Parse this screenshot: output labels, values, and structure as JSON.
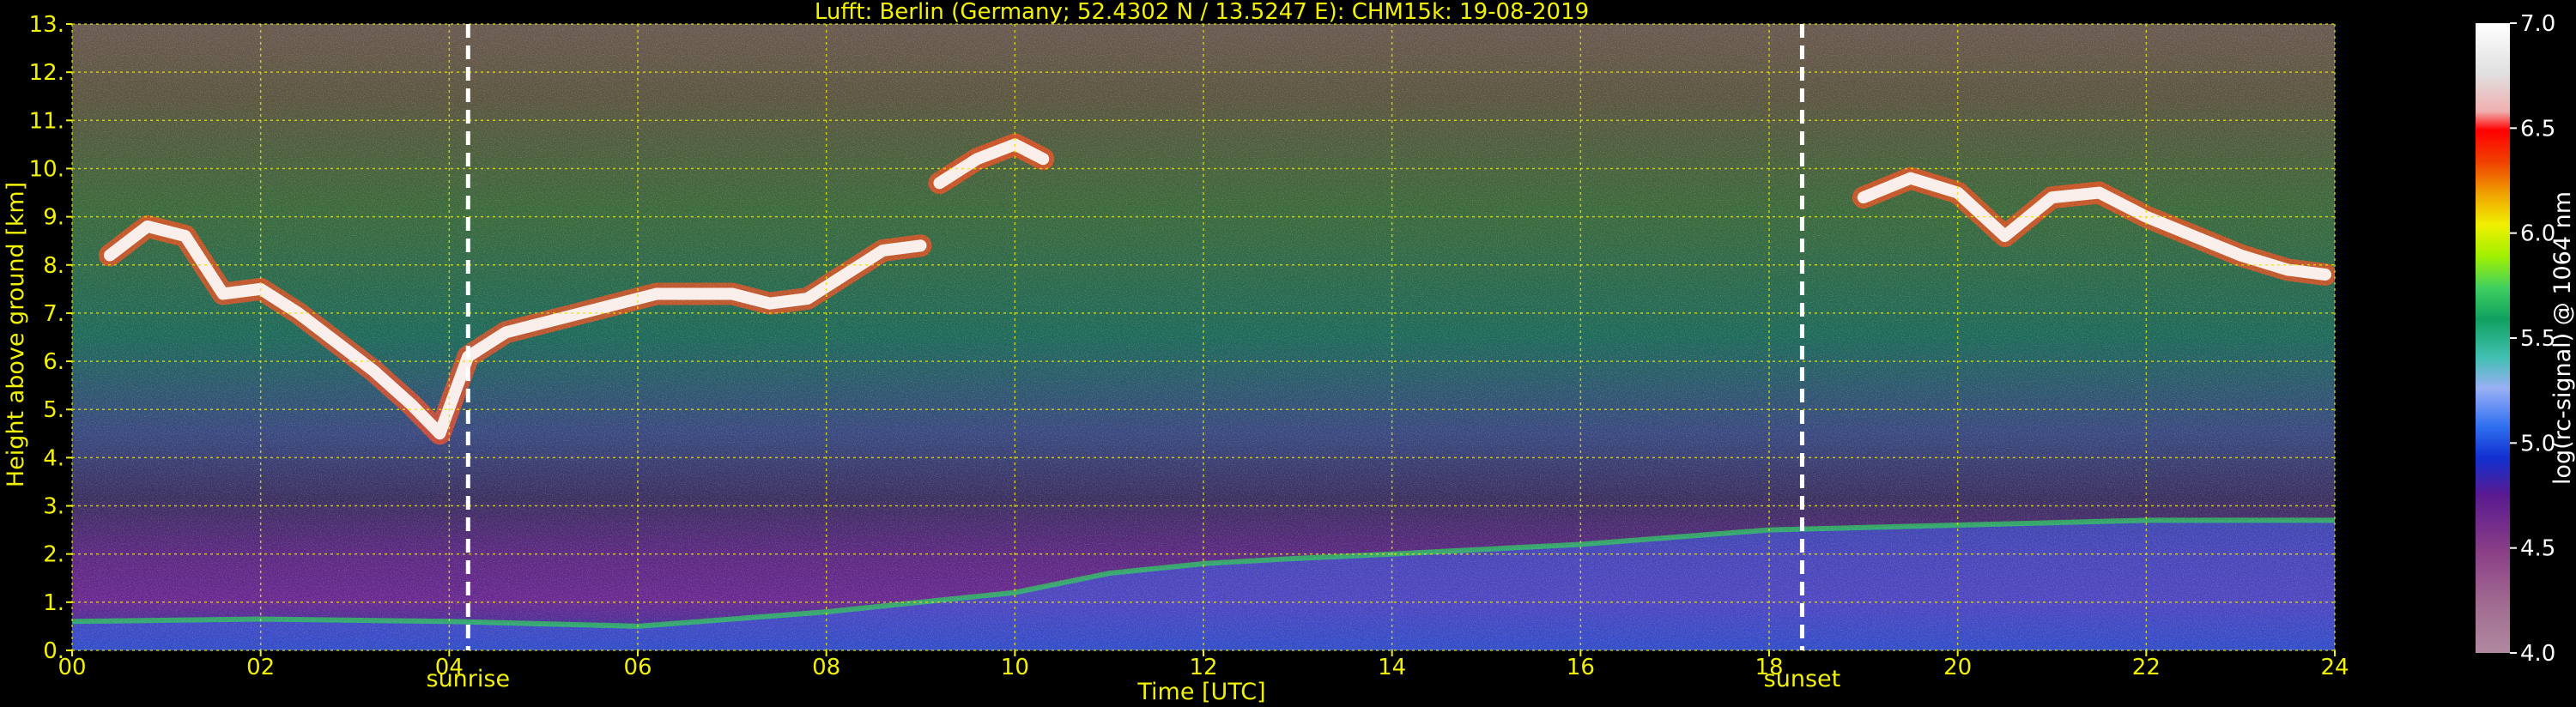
{
  "chart_data": {
    "type": "heatmap",
    "title": "Lufft: Berlin (Germany; 52.4302 N / 13.5247 E):    CHM15k: 19-08-2019",
    "xlabel": "Time [UTC]",
    "ylabel": "Height above ground [km]",
    "xlim": [
      0,
      24
    ],
    "ylim": [
      0,
      13
    ],
    "x_ticks": [
      0,
      2,
      4,
      6,
      8,
      10,
      12,
      14,
      16,
      18,
      20,
      22,
      24
    ],
    "x_tick_labels": [
      "00",
      "02",
      "04",
      "06",
      "08",
      "10",
      "12",
      "14",
      "16",
      "18",
      "20",
      "22",
      "24"
    ],
    "y_ticks": [
      0,
      1,
      2,
      3,
      4,
      5,
      6,
      7,
      8,
      9,
      10,
      11,
      12,
      13
    ],
    "y_tick_labels": [
      "0.",
      "1.",
      "2.",
      "3.",
      "4.",
      "5.",
      "6.",
      "7.",
      "8.",
      "9.",
      "10.",
      "11.",
      "12.",
      "13."
    ],
    "grid": true,
    "markers": [
      {
        "label": "sunrise",
        "x": 4.2
      },
      {
        "label": "sunset",
        "x": 18.35
      }
    ],
    "colorbar": {
      "label": "log(rc-signal) @ 1064 nm",
      "range": [
        4.0,
        7.0
      ],
      "ticks": [
        4.0,
        4.5,
        5.0,
        5.5,
        6.0,
        6.5,
        7.0
      ],
      "tick_labels": [
        "4.0",
        "4.5",
        "5.0",
        "5.5",
        "6.0",
        "6.5",
        "7.0"
      ],
      "colors": [
        "#b08aa0",
        "#a06a90",
        "#8a3f86",
        "#6a1f88",
        "#3a1aa0",
        "#1030d0",
        "#2060f0",
        "#6090f0",
        "#9ab0f5",
        "#a0d4f0",
        "#40c0b0",
        "#10a060",
        "#20b040",
        "#40d060",
        "#60e070",
        "#a0f000",
        "#f0f000",
        "#f0c000",
        "#f08000",
        "#f04000",
        "#ff0000",
        "#f0b0b0",
        "#e0e0e0",
        "#ffffff"
      ]
    },
    "series": [
      {
        "name": "",
        "x": [
          0.4,
          0.8,
          1.2,
          1.6,
          2.0,
          2.4,
          2.8,
          3.2,
          3.6,
          3.9,
          4.2,
          4.6,
          5.0,
          5.4,
          5.8,
          6.2,
          6.6,
          7.0,
          7.4,
          7.8,
          8.2,
          8.6,
          9.0
        ],
        "y": [
          8.2,
          8.8,
          8.6,
          7.4,
          7.5,
          7.0,
          6.4,
          5.8,
          5.1,
          4.5,
          6.1,
          6.6,
          6.8,
          7.0,
          7.2,
          7.4,
          7.4,
          7.4,
          7.2,
          7.3,
          7.8,
          8.3,
          8.4
        ]
      },
      {
        "name": "",
        "x": [
          9.2,
          9.6,
          10.0,
          10.3
        ],
        "y": [
          9.7,
          10.2,
          10.5,
          10.2
        ]
      },
      {
        "name": "",
        "x": [
          19.0,
          19.5,
          20.0,
          20.5,
          21.0,
          21.5,
          22.0,
          22.5,
          23.0,
          23.5,
          23.9
        ],
        "y": [
          9.4,
          9.8,
          9.5,
          8.6,
          9.4,
          9.5,
          9.0,
          8.6,
          8.2,
          7.9,
          7.8
        ]
      },
      {
        "name": "",
        "x": [
          0,
          2,
          4,
          6,
          8,
          10,
          11,
          12,
          12.9,
          14,
          16,
          18,
          20,
          22,
          24
        ],
        "y": [
          0.6,
          0.65,
          0.6,
          0.5,
          0.8,
          1.2,
          1.6,
          1.8,
          1.9,
          2.0,
          2.2,
          2.5,
          2.6,
          2.7,
          2.7
        ]
      }
    ]
  }
}
